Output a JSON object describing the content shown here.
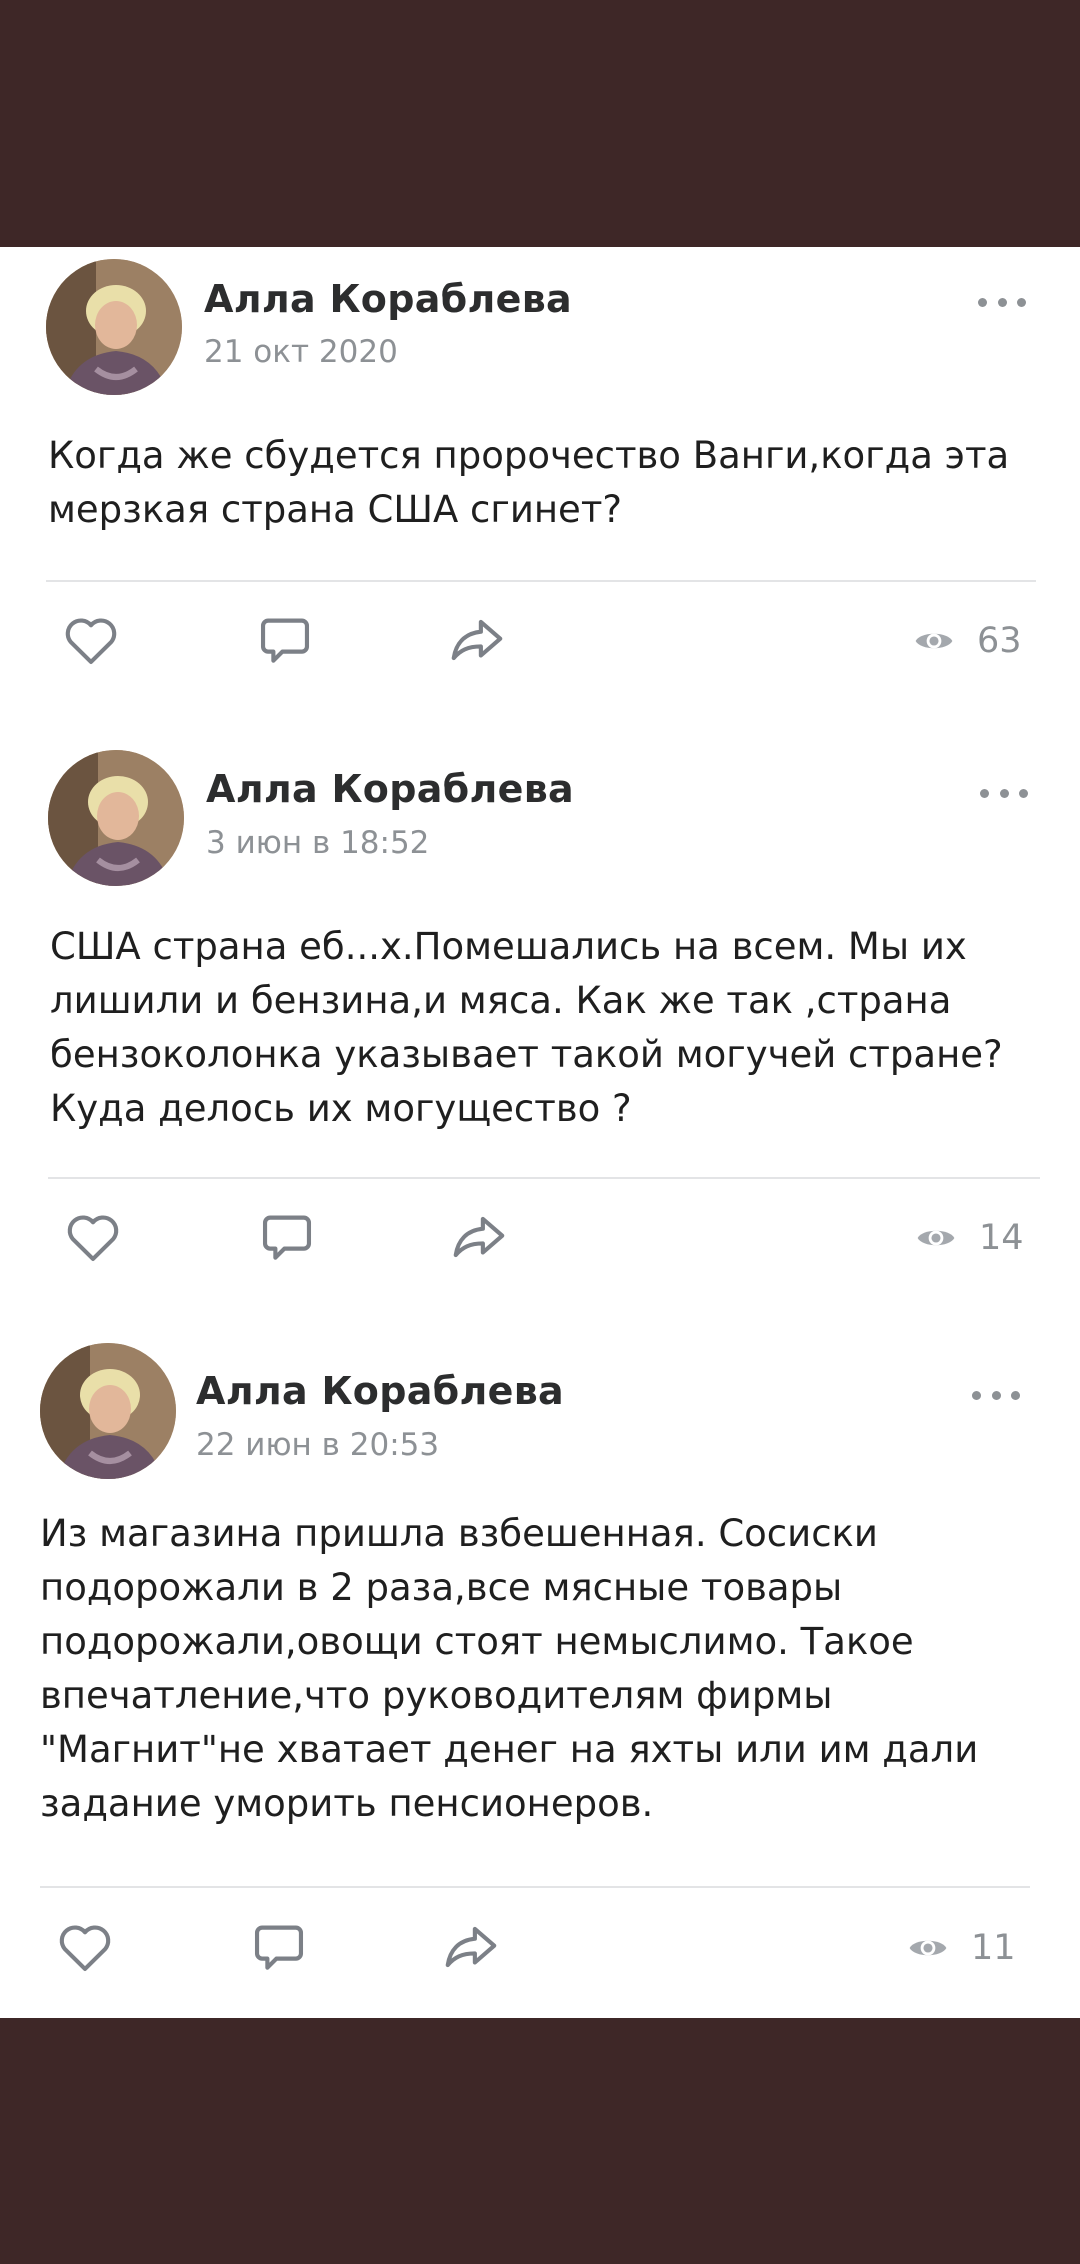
{
  "colors": {
    "background": "#3e2727",
    "card": "#ffffff",
    "text": "#1f1f1f",
    "author": "#2c2d2e",
    "secondary": "#8d9195",
    "divider": "#e3e4e6",
    "icon": "#7c8087"
  },
  "icons": {
    "like": "heart-icon",
    "comment": "comment-icon",
    "share": "share-icon",
    "views": "eye-icon",
    "menu": "more-dots-icon"
  },
  "posts": [
    {
      "author": "Алла Кораблева",
      "date": "21 окт 2020",
      "text": "Когда же сбудется пророчество Ванги,когда эта\nмерзкая страна США сгинет?",
      "views": "63"
    },
    {
      "author": "Алла Кораблева",
      "date": "3 июн в 18:52",
      "text": "США страна еб...х.Помешались на всем. Мы их\nлишили и бензина,и мяса. Как же так ,страна\nбензоколонка указывает такой могучей стране?\nКуда делось их могущество ?",
      "views": "14"
    },
    {
      "author": "Алла Кораблева",
      "date": "22 июн в 20:53",
      "text": "Из магазина пришла взбешенная. Сосиски\nподорожали в 2 раза,все мясные товары\nподорожали,овощи стоят немыслимо. Такое\nвпечатление,что руководителям фирмы\n\"Магнит\"не хватает денег на яхты или им дали\nзадание уморить пенсионеров.",
      "views": "11"
    }
  ]
}
